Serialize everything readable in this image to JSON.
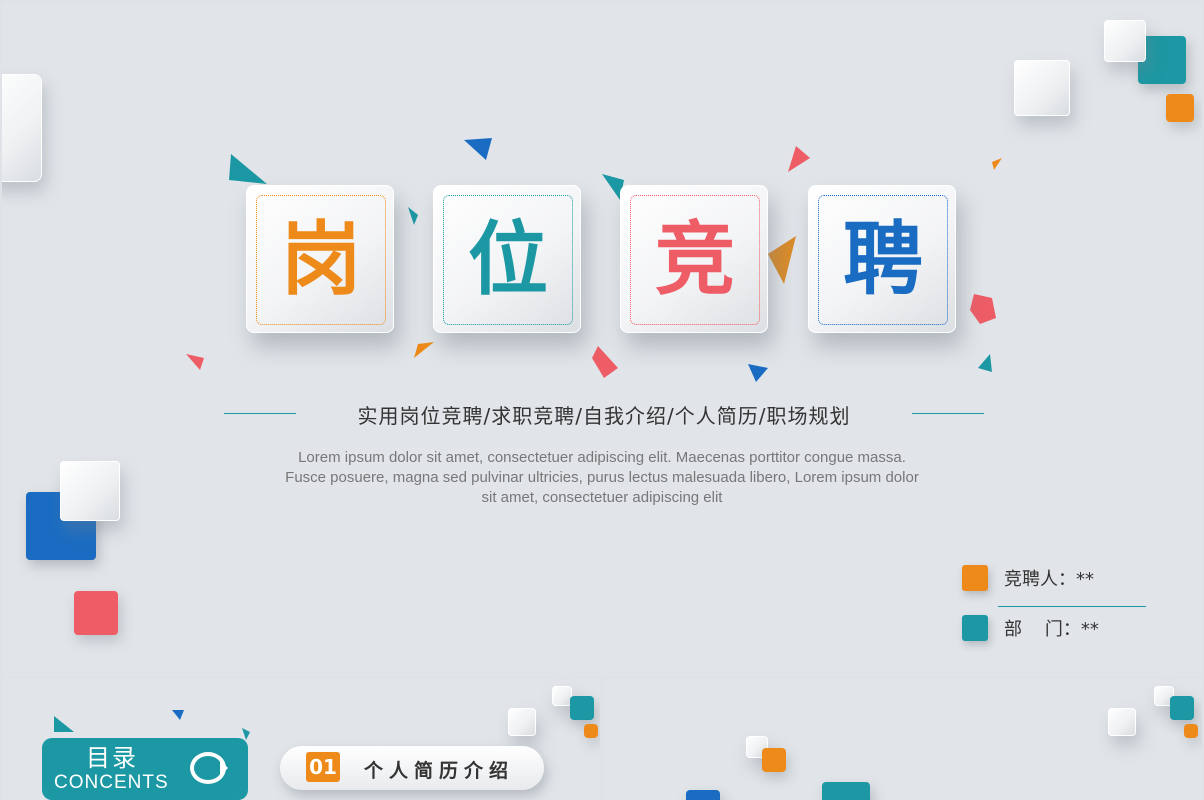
{
  "main": {
    "title_chars": [
      {
        "char": "岗",
        "color": "#ee8a1a"
      },
      {
        "char": "位",
        "color": "#1b98a3"
      },
      {
        "char": "竞",
        "color": "#ee5d66"
      },
      {
        "char": "聘",
        "color": "#1a6cc2"
      }
    ],
    "subtitle": "实用岗位竞聘/求职竞聘/自我介绍/个人简历/职场规划",
    "body_lines": [
      "Lorem ipsum dolor sit amet, consectetuer adipiscing elit. Maecenas porttitor congue massa.",
      "Fusce posuere, magna sed pulvinar ultricies, purus lectus malesuada libero, Lorem ipsum dolor",
      "sit amet, consectetuer adipiscing elit"
    ],
    "info": [
      {
        "label": "竞聘人：**",
        "color": "#ee8a1a"
      },
      {
        "label": "部    门：**",
        "color": "#1b98a3"
      }
    ]
  },
  "thumb_toc": {
    "title": "目录",
    "subtitle": "CONCENTS",
    "item_number": "01",
    "item_label": "个人简历介绍"
  },
  "colors": {
    "orange": "#ee8a1a",
    "teal": "#1b98a3",
    "red": "#ee5d66",
    "blue": "#1a6cc2",
    "background": "#e1e5e9"
  }
}
